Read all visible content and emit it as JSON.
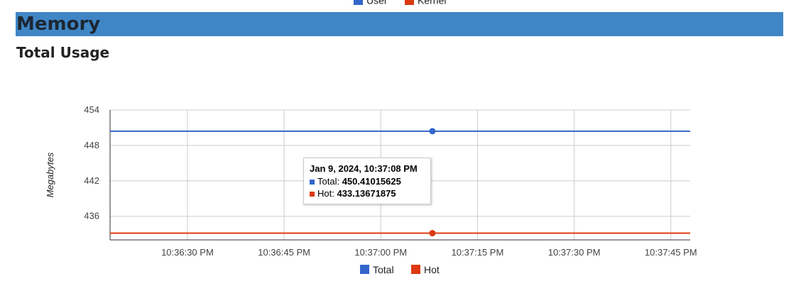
{
  "top_legend": [
    {
      "label": "User",
      "color": "#3366cc"
    },
    {
      "label": "Kernel",
      "color": "#dc3912"
    }
  ],
  "section": {
    "title": "Memory"
  },
  "subtitle": "Total Usage",
  "chart_data": {
    "type": "line",
    "ylabel": "Megabytes",
    "ylim": [
      432,
      454
    ],
    "yticks": [
      436,
      442,
      448,
      454
    ],
    "x_range": [
      "10:36:18 PM",
      "10:37:48 PM"
    ],
    "xticks": [
      "10:36:30 PM",
      "10:36:45 PM",
      "10:37:00 PM",
      "10:37:15 PM",
      "10:37:30 PM",
      "10:37:45 PM"
    ],
    "x": [
      "10:36:18 PM",
      "10:36:30 PM",
      "10:36:45 PM",
      "10:37:00 PM",
      "10:37:08 PM",
      "10:37:15 PM",
      "10:37:30 PM",
      "10:37:45 PM",
      "10:37:48 PM"
    ],
    "series": [
      {
        "name": "Total",
        "color": "#3366cc",
        "values": [
          450.41,
          450.41,
          450.41,
          450.41,
          450.41015625,
          450.41,
          450.41,
          450.41,
          450.41
        ]
      },
      {
        "name": "Hot",
        "color": "#dc3912",
        "values": [
          433.14,
          433.14,
          433.14,
          433.14,
          433.13671875,
          433.14,
          433.14,
          433.14,
          433.14
        ]
      }
    ],
    "highlight": "10:37:08 PM",
    "legend": "bottom",
    "grid": true
  },
  "tooltip": {
    "title": "Jan 9, 2024, 10:37:08 PM",
    "rows": [
      {
        "label": "Total:",
        "value": "450.41015625",
        "color": "#3366cc"
      },
      {
        "label": "Hot:",
        "value": "433.13671875",
        "color": "#dc3912"
      }
    ]
  },
  "bottom_legend": [
    {
      "label": "Total",
      "color": "#3366cc"
    },
    {
      "label": "Hot",
      "color": "#dc3912"
    }
  ]
}
